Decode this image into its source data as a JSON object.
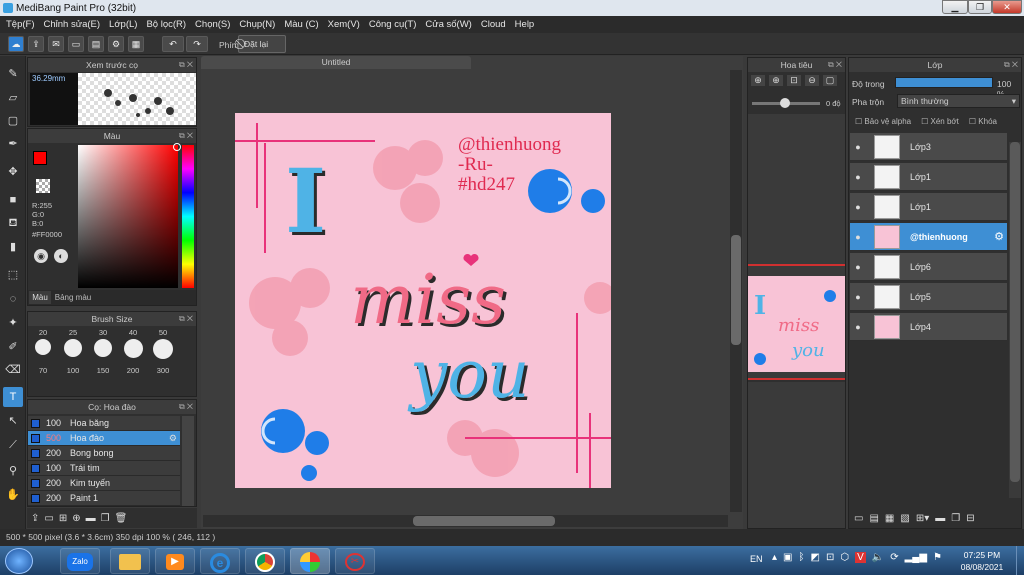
{
  "window": {
    "title": "MediBang Paint Pro (32bit)"
  },
  "menu": [
    "Tệp(F)",
    "Chỉnh sửa(E)",
    "Lớp(L)",
    "Bộ lọc(R)",
    "Chọn(S)",
    "Chụp(N)",
    "Màu (C)",
    "Xem(V)",
    "Công cụ(T)",
    "Cửa số(W)",
    "Cloud",
    "Help"
  ],
  "toolbar": {
    "stabilizer_label": "Phím",
    "reset_label": "Đặt lại"
  },
  "preview_panel": {
    "title": "Xem trước cọ",
    "size": "36.29mm"
  },
  "color_panel": {
    "title": "Màu",
    "r": "R:255",
    "g": "G:0",
    "b": "B:0",
    "hex": "#FF0000",
    "tab_color": "Màu",
    "tab_palette": "Bảng màu",
    "primary_color": "#ff0000",
    "secondary_color": "#2aa6e0"
  },
  "brush_size_panel": {
    "title": "Brush Size",
    "row1": [
      "20",
      "25",
      "30",
      "40",
      "50"
    ],
    "row2": [
      "70",
      "100",
      "150",
      "200",
      "300"
    ]
  },
  "material_panel": {
    "title": "Cọ: Hoa đào",
    "items": [
      {
        "size": "100",
        "name": "Hoa băng",
        "selected": false
      },
      {
        "size": "500",
        "name": "Hoa đào",
        "selected": true
      },
      {
        "size": "200",
        "name": "Bong bong",
        "selected": false
      },
      {
        "size": "100",
        "name": "Trái tim",
        "selected": false
      },
      {
        "size": "200",
        "name": "Kim tuyến",
        "selected": false
      },
      {
        "size": "200",
        "name": "Paint 1",
        "selected": false
      }
    ]
  },
  "document": {
    "tab_title": "Untitled"
  },
  "canvas_art": {
    "signature_line1": "@thienhuong",
    "signature_line2": "-Ru-",
    "signature_line3": "#hd247",
    "word1": "I",
    "word2": "miss",
    "word3": "you"
  },
  "navigator": {
    "title": "Hoa tiêu",
    "rotation": "0 độ"
  },
  "layer_panel": {
    "title": "Lớp",
    "opacity_label": "Độ trong",
    "opacity_value": "100 %",
    "blend_label": "Pha trộn",
    "blend_value": "Bình thường",
    "protect_alpha": "Bảo vệ alpha",
    "clipping": "Xén bớt",
    "lock": "Khóa",
    "layers": [
      {
        "name": "Lớp3",
        "selected": false
      },
      {
        "name": "Lớp1",
        "selected": false
      },
      {
        "name": "Lớp1",
        "selected": false
      },
      {
        "name": "@thienhuong",
        "selected": true
      },
      {
        "name": "Lớp6",
        "selected": false
      },
      {
        "name": "Lớp5",
        "selected": false
      },
      {
        "name": "Lớp4",
        "selected": false
      }
    ]
  },
  "status": {
    "text": "500 * 500 pixel  (3.6 * 3.6cm)  350 dpi  100 %  ( 246, 112 )"
  },
  "taskbar": {
    "lang": "EN",
    "time": "07:25 PM",
    "date": "08/08/2021",
    "zalo": "Zalo"
  }
}
